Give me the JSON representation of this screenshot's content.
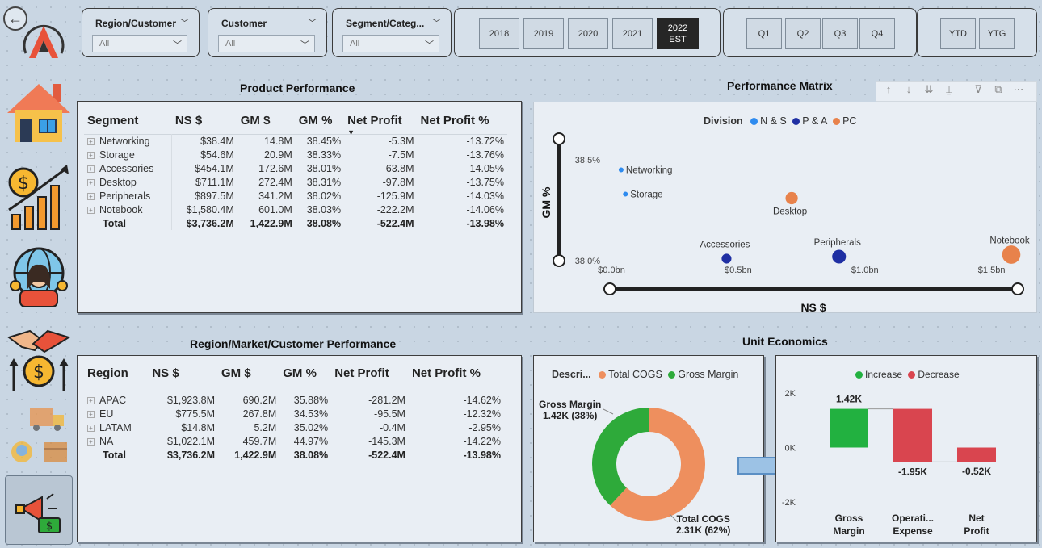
{
  "filters": [
    {
      "label": "Region/Customer",
      "value": "All"
    },
    {
      "label": "Customer",
      "value": "All"
    },
    {
      "label": "Segment/Categ...",
      "value": "All"
    }
  ],
  "years": [
    "2018",
    "2019",
    "2020",
    "2021",
    "2022 EST"
  ],
  "quarters": [
    "Q1",
    "Q2",
    "Q3",
    "Q4"
  ],
  "periods": [
    "YTD",
    "YTG"
  ],
  "product": {
    "title": "Product Performance",
    "headers": [
      "Segment",
      "NS $",
      "GM $",
      "GM %",
      "Net Profit",
      "Net Profit %"
    ],
    "rows": [
      [
        "Networking",
        "$38.4M",
        "14.8M",
        "38.45%",
        "-5.3M",
        "-13.72%"
      ],
      [
        "Storage",
        "$54.6M",
        "20.9M",
        "38.33%",
        "-7.5M",
        "-13.76%"
      ],
      [
        "Accessories",
        "$454.1M",
        "172.6M",
        "38.01%",
        "-63.8M",
        "-14.05%"
      ],
      [
        "Desktop",
        "$711.1M",
        "272.4M",
        "38.31%",
        "-97.8M",
        "-13.75%"
      ],
      [
        "Peripherals",
        "$897.5M",
        "341.2M",
        "38.02%",
        "-125.9M",
        "-14.03%"
      ],
      [
        "Notebook",
        "$1,580.4M",
        "601.0M",
        "38.03%",
        "-222.2M",
        "-14.06%"
      ]
    ],
    "total": [
      "Total",
      "$3,736.2M",
      "1,422.9M",
      "38.08%",
      "-522.4M",
      "-13.98%"
    ]
  },
  "region": {
    "title": "Region/Market/Customer Performance",
    "headers": [
      "Region",
      "NS $",
      "GM $",
      "GM %",
      "Net Profit",
      "Net Profit %"
    ],
    "rows": [
      [
        "APAC",
        "$1,923.8M",
        "690.2M",
        "35.88%",
        "-281.2M",
        "-14.62%"
      ],
      [
        "EU",
        "$775.5M",
        "267.8M",
        "34.53%",
        "-95.5M",
        "-12.32%"
      ],
      [
        "LATAM",
        "$14.8M",
        "5.2M",
        "35.02%",
        "-0.4M",
        "-2.95%"
      ],
      [
        "NA",
        "$1,022.1M",
        "459.7M",
        "44.97%",
        "-145.3M",
        "-14.22%"
      ]
    ],
    "total": [
      "Total",
      "$3,736.2M",
      "1,422.9M",
      "38.08%",
      "-522.4M",
      "-13.98%"
    ]
  },
  "matrix": {
    "title": "Performance Matrix",
    "legend_title": "Division",
    "legend": [
      {
        "name": "N & S",
        "color": "#2e8bef"
      },
      {
        "name": "P & A",
        "color": "#1f2fa3"
      },
      {
        "name": "PC",
        "color": "#e8824b"
      }
    ],
    "ylabel": "GM %",
    "xlabel": "NS $",
    "yticks": [
      "38.5%",
      "38.0%"
    ],
    "xticks": [
      "$0.0bn",
      "$0.5bn",
      "$1.0bn",
      "$1.5bn"
    ]
  },
  "unit": {
    "title": "Unit Economics",
    "donut_legend_title": "Descri...",
    "donut_legend": [
      {
        "name": "Total COGS",
        "color": "#ee8f5e"
      },
      {
        "name": "Gross Margin",
        "color": "#2eaa3a"
      }
    ],
    "gm_label": "Gross Margin",
    "gm_value": "1.42K (38%)",
    "cogs_label": "Total COGS",
    "cogs_value": "2.31K (62%)",
    "wf_legend": [
      {
        "name": "Increase",
        "color": "#22b140"
      },
      {
        "name": "Decrease",
        "color": "#d9454f"
      }
    ],
    "wf_yticks": [
      "2K",
      "0K",
      "-2K"
    ],
    "wf_values": [
      "1.42K",
      "-1.95K",
      "-0.52K"
    ],
    "wf_cats": [
      "Gross Margin",
      "Operati... Expense",
      "Net Profit"
    ]
  },
  "chart_data": [
    {
      "type": "scatter",
      "title": "Performance Matrix",
      "xlabel": "NS $",
      "ylabel": "GM %",
      "xlim": [
        0,
        1.6
      ],
      "ylim": [
        38.0,
        38.5
      ],
      "series": [
        {
          "name": "N & S",
          "points": [
            {
              "label": "Networking",
              "x": 0.038,
              "y": 38.45
            },
            {
              "label": "Storage",
              "x": 0.055,
              "y": 38.33
            }
          ]
        },
        {
          "name": "P & A",
          "points": [
            {
              "label": "Accessories",
              "x": 0.454,
              "y": 38.01
            },
            {
              "label": "Peripherals",
              "x": 0.898,
              "y": 38.02
            }
          ]
        },
        {
          "name": "PC",
          "points": [
            {
              "label": "Desktop",
              "x": 0.711,
              "y": 38.31
            },
            {
              "label": "Notebook",
              "x": 1.58,
              "y": 38.03
            }
          ]
        }
      ]
    },
    {
      "type": "pie",
      "categories": [
        "Total COGS",
        "Gross Margin"
      ],
      "values": [
        2.31,
        1.42
      ],
      "unit": "K"
    },
    {
      "type": "bar",
      "categories": [
        "Gross Margin",
        "Operati... Expense",
        "Net Profit"
      ],
      "values": [
        1.42,
        -1.95,
        -0.52
      ],
      "ylim": [
        -2,
        2
      ]
    }
  ]
}
